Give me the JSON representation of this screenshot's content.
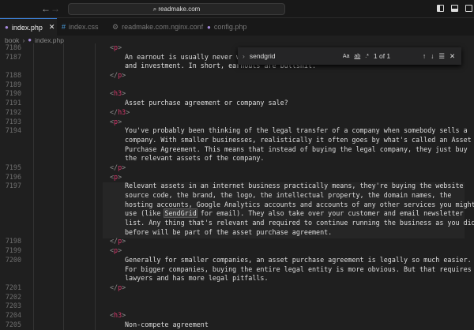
{
  "browser": {
    "address": "readmake.com"
  },
  "tabs": [
    {
      "label": "index.php",
      "icon": "php-icon",
      "active": true
    },
    {
      "label": "index.css",
      "icon": "hash-icon"
    },
    {
      "label": "readmake.com.nginx.conf",
      "icon": "gear-icon"
    },
    {
      "label": "config.php",
      "icon": "php-icon"
    }
  ],
  "breadcrumb": {
    "folder": "book",
    "file": "index.php"
  },
  "find": {
    "query": "sendgrid",
    "count": "1 of 1",
    "case_label": "Aa",
    "word_label": "ab",
    "regex_label": ".*"
  },
  "lines": [
    {
      "n": "7186",
      "t": "<p>",
      "k": "o"
    },
    {
      "n": "7187",
      "t": "An earnout is usually never wor",
      "k": "x"
    },
    {
      "n": "",
      "t": "and investment. In short, earnouts are bullshit.",
      "k": "x"
    },
    {
      "n": "7188",
      "t": "</p>",
      "k": "o"
    },
    {
      "n": "7189",
      "t": "",
      "k": "o"
    },
    {
      "n": "7190",
      "t": "<h3>",
      "k": "o"
    },
    {
      "n": "7191",
      "t": "Asset purchase agreement or company sale?",
      "k": "x"
    },
    {
      "n": "7192",
      "t": "</h3>",
      "k": "o"
    },
    {
      "n": "7193",
      "t": "<p>",
      "k": "o"
    },
    {
      "n": "7194",
      "t": "You've probably been thinking of the legal transfer of a company when somebody sells a",
      "k": "x"
    },
    {
      "n": "",
      "t": "company. With smaller businesses, realistically it often goes by what's called an Asset",
      "k": "x"
    },
    {
      "n": "",
      "t": "Purchase Agreement. This means that instead of buying the legal company, they just buy",
      "k": "x"
    },
    {
      "n": "",
      "t": "the relevant assets of the company.",
      "k": "x"
    },
    {
      "n": "7195",
      "t": "</p>",
      "k": "o"
    },
    {
      "n": "7196",
      "t": "<p>",
      "k": "o"
    },
    {
      "n": "7197",
      "t": "Relevant assets in an internet business practically means, they're buying the website",
      "k": "x"
    },
    {
      "n": "",
      "t": "source code, the brand, the logo, the intellectual property, the domain names, the",
      "k": "x"
    },
    {
      "n": "",
      "t": "hosting accounts, Google Analytics accounts and accounts of any other services you might",
      "k": "x"
    },
    {
      "n": "",
      "t": "use (like ",
      "m": "SendGrid",
      "a": " for email). They also take over your customer and email newsletter",
      "k": "x"
    },
    {
      "n": "",
      "t": "list. Any thing that's relevant and required to continue running the business as you did",
      "k": "x"
    },
    {
      "n": "",
      "t": "before will be part of the asset purchase agreement.",
      "k": "x"
    },
    {
      "n": "7198",
      "t": "</p>",
      "k": "o"
    },
    {
      "n": "7199",
      "t": "<p>",
      "k": "o"
    },
    {
      "n": "7200",
      "t": "Generally for smaller companies, an asset purchase agreement is legally so much easier.",
      "k": "x"
    },
    {
      "n": "",
      "t": "For bigger companies, buying the entire legal entity is more obvious. But that requires",
      "k": "x"
    },
    {
      "n": "",
      "t": "lawyers and has more legal pitfalls.",
      "k": "x"
    },
    {
      "n": "7201",
      "t": "</p>",
      "k": "o"
    },
    {
      "n": "7202",
      "t": "",
      "k": "o"
    },
    {
      "n": "7203",
      "t": "",
      "k": "o"
    },
    {
      "n": "7204",
      "t": "<h3>",
      "k": "o"
    },
    {
      "n": "7205",
      "t": "Non-compete agreement",
      "k": "x"
    }
  ]
}
